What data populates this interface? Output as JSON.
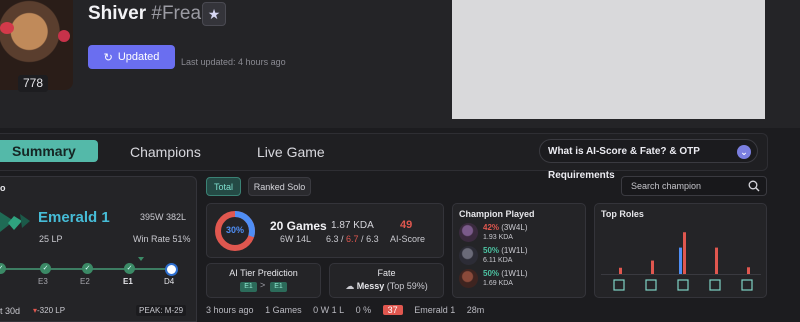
{
  "profile": {
    "name": "Shiver",
    "tag": "#Freak",
    "level": "778",
    "update_label": "Updated",
    "last_updated": "Last updated: 4 hours ago"
  },
  "tabs": {
    "summary": "Summary",
    "champions": "Champions",
    "live_game": "Live Game",
    "info_button": "What is AI-Score & Fate? & OTP Requirements"
  },
  "rank": {
    "title": "o",
    "tier": "Emerald 1",
    "lp": "25 LP",
    "wl": "395W 382L",
    "win_rate": "Win Rate 51%",
    "progress_labels": [
      "E3",
      "E2",
      "E1",
      "D4"
    ],
    "period": "t 30d",
    "lp_change": "-320 LP",
    "peak": "PEAK: M-29"
  },
  "filters": {
    "total": "Total",
    "ranked_solo": "Ranked Solo",
    "search_placeholder": "Search champion"
  },
  "stats": {
    "win_pct_label": "30%",
    "win_pct": 30,
    "games": "20 Games",
    "wl": "6W 14L",
    "kda": "1.87 KDA",
    "kills": "6.3",
    "deaths": "6.7",
    "assists": "6.3",
    "sep": " / ",
    "ai_score": "49",
    "ai_score_label": "AI-Score"
  },
  "tier_prediction": {
    "title": "AI Tier Prediction",
    "from": "E1",
    "arrow": ">",
    "to": "E1"
  },
  "fate": {
    "title": "Fate",
    "value": "Messy",
    "detail": "(Top 59%)"
  },
  "champions_played": {
    "title": "Champion Played",
    "items": [
      {
        "wr": "42%",
        "record": "(3W4L)",
        "kda": "1.93 KDA",
        "color": "#e0574f"
      },
      {
        "wr": "50%",
        "record": "(1W1L)",
        "kda": "6.11 KDA",
        "color": "#4cc3a2"
      },
      {
        "wr": "50%",
        "record": "(1W1L)",
        "kda": "1.69 KDA",
        "color": "#4cc3a2"
      }
    ]
  },
  "roles": {
    "title": "Top Roles",
    "role_icons": [
      "top-icon",
      "jungle-icon",
      "mid-icon",
      "bottom-icon",
      "support-icon"
    ],
    "blue": [
      0,
      0,
      0.55,
      0,
      0
    ],
    "red": [
      0.13,
      0.28,
      0.87,
      0.55,
      0.14
    ]
  },
  "recent": {
    "time": "3 hours ago",
    "games": "1 Games",
    "record": "0 W 1 L",
    "pct": "0 %",
    "score": "37",
    "tier": "Emerald 1",
    "duration": "28m"
  },
  "colors": {
    "accent": "#54b9a9",
    "update": "#6a6ef0",
    "loss": "#e0574f",
    "win": "#4f8ef5",
    "tier": "#46bcd7"
  }
}
